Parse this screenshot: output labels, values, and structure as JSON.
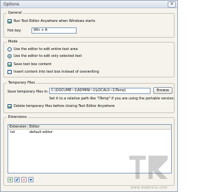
{
  "window": {
    "title": "Options",
    "close_glyph": "✕"
  },
  "general": {
    "title": "General",
    "run_text_editor": {
      "label": "Run Text Editor Anywhere when Windows starts",
      "checked": true
    },
    "hot_key": {
      "label": "Hot key:",
      "value": "Win + A"
    }
  },
  "mode": {
    "title": "Mode",
    "options": [
      {
        "label": "Use the editor to edit entire text area",
        "selected": false
      },
      {
        "label": "Use the editor to edit only selected text",
        "selected": true
      }
    ],
    "save_text_box": {
      "label": "Save text box content",
      "checked": true
    },
    "insert_content": {
      "label": "Insert content into text box instead of overwriting",
      "checked": false
    }
  },
  "temporary_files": {
    "title": "Temporary Files",
    "save_label": "Save temporary files in:",
    "path_value": "C:\\DOCUME~1\\ADMINI~1\\LOCALS~1\\Temp\\",
    "browse_label": "Browse",
    "hint": "Set it to a relative path like \"\\Temp\" if you are using the portable version.",
    "delete_files": {
      "label": "Delete temporary files before closing Text Editor Anywhere",
      "checked": true
    }
  },
  "extensions": {
    "title": "Extensions",
    "columns": [
      "Extension",
      "Editor"
    ],
    "rows": [
      {
        "extension": "txt",
        "editor": "default editor"
      }
    ],
    "toolbar_icons": [
      "add-icon",
      "edit-icon",
      "delete-icon",
      "move-down-icon"
    ]
  },
  "watermark": {
    "caption": "www.downxia.com"
  }
}
